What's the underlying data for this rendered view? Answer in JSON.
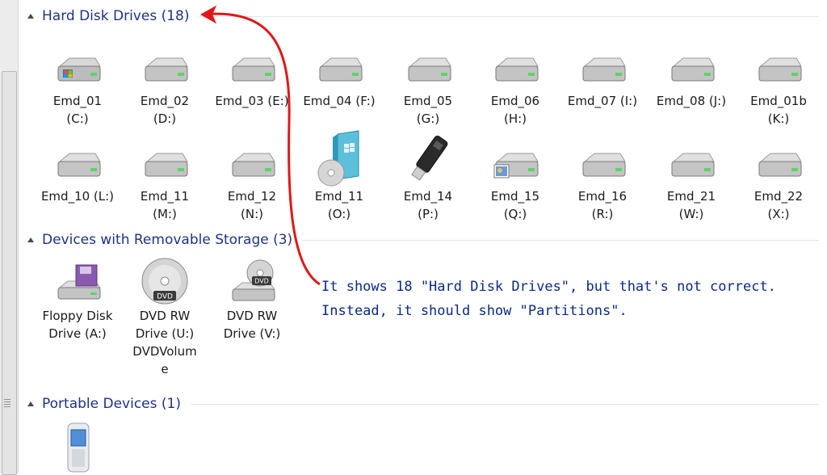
{
  "groups": [
    {
      "title": "Hard Disk Drives (18)",
      "items": [
        {
          "name": "Emd_01",
          "letter": "(C:)",
          "icon": "system-drive-icon"
        },
        {
          "name": "Emd_02",
          "letter": "(D:)",
          "icon": "hard-drive-icon"
        },
        {
          "name": "Emd_03 (E:)",
          "letter": "",
          "icon": "hard-drive-icon"
        },
        {
          "name": "Emd_04 (F:)",
          "letter": "",
          "icon": "hard-drive-icon"
        },
        {
          "name": "Emd_05",
          "letter": "(G:)",
          "icon": "hard-drive-icon"
        },
        {
          "name": "Emd_06",
          "letter": "(H:)",
          "icon": "hard-drive-icon"
        },
        {
          "name": "Emd_07 (I:)",
          "letter": "",
          "icon": "hard-drive-icon"
        },
        {
          "name": "Emd_08 (J:)",
          "letter": "",
          "icon": "hard-drive-icon"
        },
        {
          "name": "Emd_01b",
          "letter": "(K:)",
          "icon": "hard-drive-icon"
        },
        {
          "name": "Emd_10 (L:)",
          "letter": "",
          "icon": "hard-drive-icon"
        },
        {
          "name": "Emd_11",
          "letter": "(M:)",
          "icon": "hard-drive-icon"
        },
        {
          "name": "Emd_12",
          "letter": "(N:)",
          "icon": "hard-drive-icon"
        },
        {
          "name": "Emd_11",
          "letter": "(O:)",
          "icon": "windows-install-disc-icon"
        },
        {
          "name": "Emd_14",
          "letter": "(P:)",
          "icon": "usb-stick-icon"
        },
        {
          "name": "Emd_15",
          "letter": "(Q:)",
          "icon": "hard-drive-with-picture-icon"
        },
        {
          "name": "Emd_16",
          "letter": "(R:)",
          "icon": "hard-drive-icon"
        },
        {
          "name": "Emd_21",
          "letter": "(W:)",
          "icon": "hard-drive-icon"
        },
        {
          "name": "Emd_22",
          "letter": "(X:)",
          "icon": "hard-drive-icon"
        }
      ]
    },
    {
      "title": "Devices with Removable Storage (3)",
      "items": [
        {
          "name": "Floppy Disk",
          "letter": "Drive (A:)",
          "icon": "floppy-drive-icon"
        },
        {
          "name": "DVD RW",
          "letter": "Drive (U:)\nDVDVolum\ne",
          "icon": "dvd-disc-icon"
        },
        {
          "name": "DVD RW",
          "letter": "Drive (V:)",
          "icon": "dvd-drive-icon"
        }
      ]
    },
    {
      "title": "Portable Devices (1)",
      "items": [
        {
          "name": "",
          "letter": "",
          "icon": "mobile-phone-icon"
        }
      ]
    }
  ],
  "annotation": {
    "line1": "It shows 18 \"Hard Disk Drives\", but that's not correct.",
    "line2": "Instead, it should show \"Partitions\"."
  },
  "colors": {
    "header_text": "#1e3287",
    "annotation_text": "#0a2a8a",
    "arrow": "#e01818"
  }
}
